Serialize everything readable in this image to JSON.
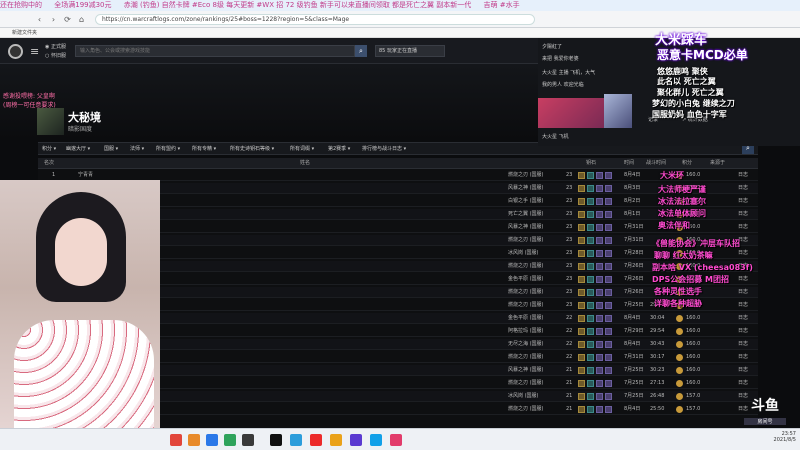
{
  "banner": [
    "还在抢购中的",
    "全场满199减30元",
    "赤潮 (钓鱼) 自然卡牌 #Eco 8级 每天更新 #WX 招 72 级钓鱼 新手可以来直播间领取 都是死亡之翼 副本新一代",
    "吉萌 #水手"
  ],
  "browser": {
    "url": "https://cn.warcraftlogs.com/zone/rankings/25#boss=1228?region=5&class=Mage",
    "bookmark": "新建文件夹",
    "back_label": "‹",
    "forward_label": "›",
    "reload_label": "⟳",
    "home_label": "⌂"
  },
  "site": {
    "radio_1": "正式服",
    "radio_2": "怀旧服",
    "search_placeholder": "输入角色、公会或搜索游戏技能",
    "search_button": "⌕",
    "live_label": "85 玩家正在直播",
    "menu_icon": "≡"
  },
  "zone": {
    "name": "大秘境",
    "subtitle": "暗影国度"
  },
  "tabs": [
    {
      "label": "积分 ▾"
    },
    {
      "label": "幽邃大厅 ▾"
    },
    {
      "label": "国服 ▾"
    },
    {
      "label": "法师 ▾"
    },
    {
      "label": "所有盟约 ▾"
    },
    {
      "label": "所有专精 ▾"
    },
    {
      "label": "所有史诗钥石等级 ▾"
    },
    {
      "label": "所有词缀 ▾"
    },
    {
      "label": "第2赛季 ▾"
    },
    {
      "label": "排行榜与战斗日志 ▾"
    }
  ],
  "table": {
    "headers": [
      "名次",
      "姓名",
      "钥石",
      "时间",
      "战斗时间",
      "积分",
      "来源于"
    ],
    "rows": [
      {
        "rank": "1",
        "name": "宁青青",
        "server": "燃烧之刃 (国服)",
        "key": "23",
        "date": "8月4日",
        "time": "",
        "score": "160.0",
        "log": "日志"
      },
      {
        "rank": "",
        "name": "",
        "server": "风暴之神 (国服)",
        "key": "23",
        "date": "8月3日",
        "time": "",
        "score": "160.0",
        "log": "日志"
      },
      {
        "rank": "",
        "name": "",
        "server": "白银之手 (国服)",
        "key": "23",
        "date": "8月2日",
        "time": "",
        "score": "160.0",
        "log": "日志"
      },
      {
        "rank": "",
        "name": "",
        "server": "死亡之翼 (国服)",
        "key": "23",
        "date": "8月1日",
        "time": "",
        "score": "160.0",
        "log": "日志"
      },
      {
        "rank": "",
        "name": "",
        "server": "风暴之神 (国服)",
        "key": "23",
        "date": "7月31日",
        "time": "",
        "score": "160.0",
        "log": "日志"
      },
      {
        "rank": "",
        "name": "",
        "server": "燃烧之刃 (国服)",
        "key": "23",
        "date": "7月31日",
        "time": "",
        "score": "160.0",
        "log": "日志"
      },
      {
        "rank": "",
        "name": "",
        "server": "冰风岗 (国服)",
        "key": "23",
        "date": "7月28日",
        "time": "",
        "score": "160.0",
        "log": "日志"
      },
      {
        "rank": "",
        "name": "",
        "server": "燃烧之刃 (国服)",
        "key": "23",
        "date": "7月26日",
        "time": "",
        "score": "160.0",
        "log": "日志"
      },
      {
        "rank": "",
        "name": "",
        "server": "金色平原 (国服)",
        "key": "23",
        "date": "7月26日",
        "time": "",
        "score": "160.0",
        "log": "日志"
      },
      {
        "rank": "",
        "name": "",
        "server": "燃烧之刃 (国服)",
        "key": "23",
        "date": "7月26日",
        "time": "",
        "score": "160.0",
        "log": "日志"
      },
      {
        "rank": "",
        "name": "",
        "server": "燃烧之刃 (国服)",
        "key": "23",
        "date": "7月25日",
        "time": "29:27",
        "score": "161.0",
        "log": "日志"
      },
      {
        "rank": "",
        "name": "",
        "server": "金色平原 (国服)",
        "key": "22",
        "date": "8月4日",
        "time": "30:04",
        "score": "160.0",
        "log": "日志"
      },
      {
        "rank": "",
        "name": "",
        "server": "阿格拉玛 (国服)",
        "key": "22",
        "date": "7月29日",
        "time": "29:54",
        "score": "160.0",
        "log": "日志"
      },
      {
        "rank": "",
        "name": "",
        "server": "无尽之海 (国服)",
        "key": "22",
        "date": "8月4日",
        "time": "30:43",
        "score": "160.0",
        "log": "日志"
      },
      {
        "rank": "",
        "name": "",
        "server": "燃烧之刃 (国服)",
        "key": "22",
        "date": "7月31日",
        "time": "30:17",
        "score": "160.0",
        "log": "日志"
      },
      {
        "rank": "",
        "name": "",
        "server": "风暴之神 (国服)",
        "key": "21",
        "date": "7月25日",
        "time": "30:23",
        "score": "160.0",
        "log": "日志"
      },
      {
        "rank": "",
        "name": "",
        "server": "燃烧之刃 (国服)",
        "key": "21",
        "date": "7月25日",
        "time": "27:13",
        "score": "160.0",
        "log": "日志"
      },
      {
        "rank": "",
        "name": "",
        "server": "冰风岗 (国服)",
        "key": "21",
        "date": "7月25日",
        "time": "26:48",
        "score": "157.0",
        "log": "日志"
      },
      {
        "rank": "",
        "name": "",
        "server": "燃烧之刃 (国服)",
        "key": "21",
        "date": "8月4日",
        "time": "25:50",
        "score": "157.0",
        "log": "日志"
      }
    ]
  },
  "overlay_left": [
    "感谢投喂榜: 父皇啊",
    "(周榜一可任意要求)"
  ],
  "right_panel": {
    "rows": [
      "夕陽紅了",
      "来把 我爱你老婆",
      "大火星  主播 飞机，大气",
      "我的男人 欢迎光临",
      "大火星 飞机"
    ],
    "title_1": "大米踩车",
    "title_2": "恶意卡MCD必单",
    "link_1": "记录",
    "link_2": "↗ 统计数据"
  },
  "overlay_right_white": [
    "悠悠鹿鸣 聚侠",
    "此名以 死亡之翼",
    "聚化群儿 死亡之翼",
    "梦幻的小白兔 继续之刀",
    "国服奶妈 血色十字军"
  ],
  "overlay_right_pink": [
    "大米环",
    "大法师梗严谨",
    "冰法法拉塞尔",
    "冰法单体顾问",
    "奥法伴和",
    "",
    "《兽能协会》冲层车队招",
    "聊聊 红太奶茶嘛",
    "副本啥 VX (cheesa083f)",
    "DPS公会招募 M团招",
    "各种灵性选手",
    "详聊各种超胁"
  ],
  "taskbar": {
    "time": "23:57",
    "date": "2021/8/5"
  },
  "watermark": {
    "main": "斗鱼",
    "sub": "房间号"
  },
  "colors": {
    "pink": "#ff4bd0",
    "accent": "#3c4f6d",
    "score": "#c89a3a"
  }
}
